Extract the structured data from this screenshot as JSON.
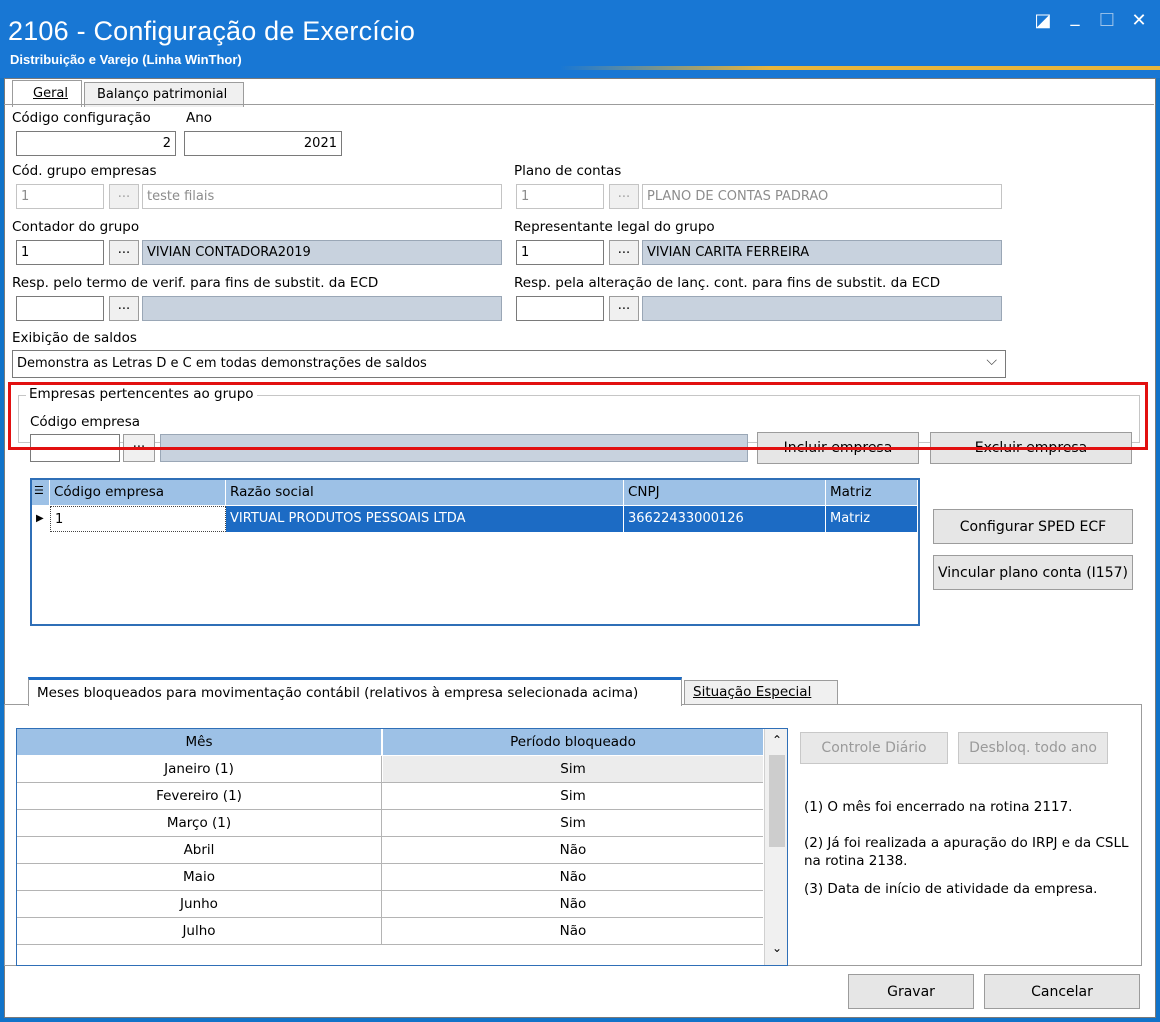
{
  "window": {
    "title": "2106 - Configuração de Exercício",
    "subtitle": "Distribuição e Varejo (Linha WinThor)",
    "controls": {
      "restore": "◪",
      "minimize": "_",
      "maximize": "☐",
      "close": "✕"
    }
  },
  "tabs": {
    "geral": "Geral",
    "balanco": "Balanço patrimonial"
  },
  "form": {
    "codigo_configuracao_label": "Código configuração",
    "codigo_configuracao_value": "2",
    "ano_label": "Ano",
    "ano_value": "2021",
    "grupo_empresas_label": "Cód. grupo empresas",
    "grupo_empresas_code": "1",
    "grupo_empresas_name": "teste filais",
    "plano_contas_label": "Plano de contas",
    "plano_contas_code": "1",
    "plano_contas_name": "PLANO DE CONTAS PADRAO",
    "contador_label": "Contador do grupo",
    "contador_code": "1",
    "contador_name": "VIVIAN CONTADORA2019",
    "representante_label": "Representante legal do grupo",
    "representante_code": "1",
    "representante_name": "VIVIAN CARITA FERREIRA",
    "resp_termo_label": "Resp. pelo termo de verif. para fins de substit. da ECD",
    "resp_alteracao_label": "Resp. pela alteração de lanç. cont. para fins de substit. da ECD",
    "exibicao_label": "Exibição de saldos",
    "exibicao_value": "Demonstra as Letras D e C em todas demonstrações de saldos",
    "dots": "...",
    "chevron": "⌵"
  },
  "empresas_group": {
    "title": "Empresas pertencentes ao grupo",
    "codigo_label": "Código empresa",
    "incluir_button": "Incluir empresa",
    "excluir_button": "Excluir empresa"
  },
  "companies_grid": {
    "columns": [
      "Código empresa",
      "Razão social",
      "CNPJ",
      "Matriz"
    ],
    "rows": [
      {
        "codigo": "1",
        "razao": "VIRTUAL PRODUTOS PESSOAIS LTDA",
        "cnpj": "36622433000126",
        "matriz": "Matriz"
      }
    ]
  },
  "side_buttons": {
    "sped": "Configurar SPED ECF",
    "vincular": "Vincular plano conta (I157)"
  },
  "months_tabs": {
    "bloqueados": "Meses bloqueados para movimentação contábil (relativos à empresa selecionada acima)",
    "especial": "Situação Especial"
  },
  "months_table": {
    "columns": [
      "Mês",
      "Período bloqueado"
    ],
    "rows": [
      {
        "mes": "Janeiro (1)",
        "bloqueado": "Sim"
      },
      {
        "mes": "Fevereiro (1)",
        "bloqueado": "Sim"
      },
      {
        "mes": "Março (1)",
        "bloqueado": "Sim"
      },
      {
        "mes": "Abril",
        "bloqueado": "Não"
      },
      {
        "mes": "Maio",
        "bloqueado": "Não"
      },
      {
        "mes": "Junho",
        "bloqueado": "Não"
      },
      {
        "mes": "Julho",
        "bloqueado": "Não"
      }
    ]
  },
  "months_buttons": {
    "controle": "Controle Diário",
    "desbloq": "Desbloq. todo ano"
  },
  "notes": [
    "(1)  O mês foi encerrado na rotina 2117.",
    "(2)  Já foi realizada a apuração do IRPJ e da CSLL na rotina 2138.",
    "(3)  Data de início de atividade da empresa."
  ],
  "footer": {
    "gravar": "Gravar",
    "cancelar": "Cancelar"
  },
  "colors": {
    "title_bar": "#1877d4",
    "grid_selection": "#1c6bc4",
    "grid_header": "#9dc1e6",
    "highlight_box": "#e21010"
  }
}
